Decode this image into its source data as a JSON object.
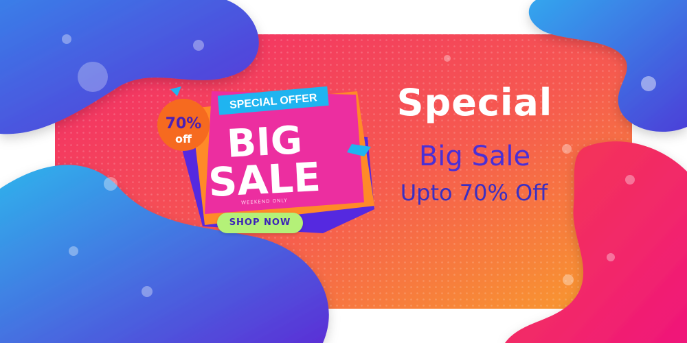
{
  "banner": {
    "badge": {
      "percent": "70%",
      "suffix": "off"
    },
    "ribbon": "SPECIAL OFFER",
    "big": "BIG",
    "sale": "SALE",
    "weekend": "WEEKEND ONLY",
    "cta": "SHOP NOW",
    "headline": "Special",
    "subline1": "Big Sale",
    "subline2": "Upto 70% Off"
  },
  "colors": {
    "panel_start": "#f2286a",
    "panel_end": "#f89d2c",
    "blob_blue_top": "#2fb3ec",
    "blob_blue_bottom": "#5b35d6",
    "sticker_pink": "#ec2ea0",
    "sticker_purple": "#5529e0",
    "ribbon_cyan": "#1fb4f0",
    "badge_orange": "#f66a1f",
    "cta_green": "#b4f178",
    "text_purple": "#4a2fd6"
  }
}
